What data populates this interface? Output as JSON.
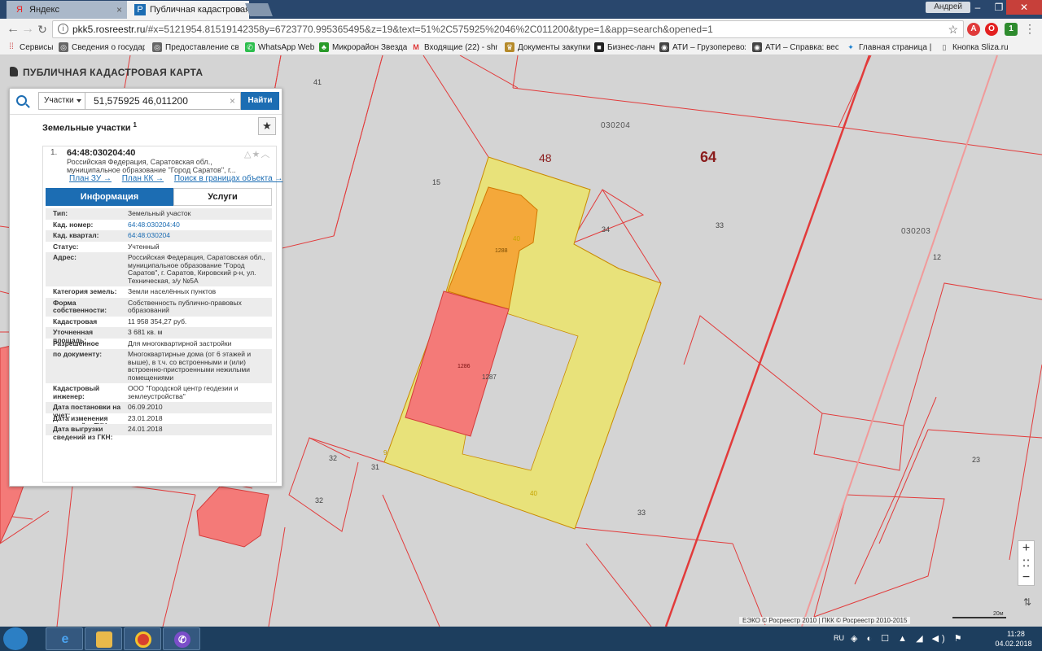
{
  "browser": {
    "tabs": [
      {
        "label": "Яндекс",
        "icon": "yandex-icon"
      },
      {
        "label": "Публичная кадастровая",
        "icon": "rosreestr-icon"
      }
    ],
    "user": "Андрей",
    "url_host": "pkk5.rosreestr.ru",
    "url_rest": "/#x=5121954.81519142358y=6723770.995365495&z=19&text=51%2C575925%2046%2C011200&type=1&app=search&opened=1",
    "bookmarks": [
      "Сервисы",
      "Сведения о государ",
      "Предоставление све",
      "WhatsApp Web",
      "Микрорайон Звезда",
      "Входящие (22) - shm",
      "Документы закупки",
      "Бизнес-ланч",
      "АТИ – Грузоперевоз",
      "АТИ – Справка: весе",
      "Главная страница | К",
      "Кнопка Sliza.ru"
    ]
  },
  "map": {
    "title": "ПУБЛИЧНАЯ КАДАСТРОВАЯ КАРТА",
    "labels": {
      "q030204": "030204",
      "q030203": "030203",
      "big48": "48",
      "big64": "64",
      "n41": "41",
      "n15": "15",
      "n34": "34",
      "n33a": "33",
      "n33b": "33",
      "n12": "12",
      "n23": "23",
      "n32a": "32",
      "n32b": "32",
      "n31": "31",
      "n40a": "40",
      "n40b": "40",
      "n1288": "1288",
      "n1286": "1286",
      "n1287": "1287",
      "n9": "9"
    },
    "copyright": "ЕЭКО © Росреестр 2010 | ПКК © Росреестр 2010-2015",
    "scale": "20м",
    "zoom_in": "+",
    "zoom_out": "−"
  },
  "search": {
    "type": "Участки",
    "query": "51,575925 46,011200",
    "button": "Найти"
  },
  "results": {
    "title": "Земельные участки",
    "count": "1",
    "item": {
      "index": "1.",
      "cad_number": "64:48:030204:40",
      "address_short": "Российская Федерация, Саратовская обл., муниципальное образование \"Город Саратов\", г...",
      "links": [
        "План ЗУ →",
        "План КК →",
        "Поиск в границах объекта →"
      ],
      "tab_info": "Информация",
      "tab_services": "Услуги",
      "props": [
        {
          "label": "Тип:",
          "value": "Земельный участок"
        },
        {
          "label": "Кад. номер:",
          "value": "64:48:030204:40",
          "link": true
        },
        {
          "label": "Кад. квартал:",
          "value": "64:48:030204",
          "link": true
        },
        {
          "label": "Статус:",
          "value": "Учтенный"
        },
        {
          "label": "Адрес:",
          "value": "Российская Федерация, Саратовская обл., муниципальное образование \"Город Саратов\", г. Саратов, Кировский р-н, ул. Техническая, з/у №5А"
        },
        {
          "label": "Категория земель:",
          "value": "Земли населённых пунктов"
        },
        {
          "label": "Форма собственности:",
          "value": "Собственность публично-правовых образований"
        },
        {
          "label": "Кадастровая стоимость:",
          "value": "11 958 354,27 руб."
        },
        {
          "label": "Уточненная площадь:",
          "value": "3 681 кв. м"
        },
        {
          "label": "Разрешенное использование:",
          "value": "Для многоквартирной застройки"
        },
        {
          "label": "по документу:",
          "value": "Многоквартирные дома (от 6 этажей и выше), в т.ч. со встроенными и (или) встроенно-пристроенными нежилыми помещениями"
        },
        {
          "label": "Кадастровый инженер:",
          "value": "ООО \"Городской центр геодезии и землеустройства\""
        },
        {
          "label": "Дата постановки на учет:",
          "value": "06.09.2010"
        },
        {
          "label": "Дата изменения сведений в ГКН:",
          "value": "23.01.2018"
        },
        {
          "label": "Дата выгрузки сведений из ГКН:",
          "value": "24.01.2018"
        }
      ]
    }
  },
  "taskbar": {
    "lang": "RU",
    "time": "11:28",
    "date": "04.02.2018"
  },
  "colors": {
    "parcel_yellow": "#e8e27a",
    "building_orange": "#f4a83a",
    "building_red": "#f47a78",
    "boundary_red": "#e23b3b",
    "accent_blue": "#1c6db3"
  }
}
